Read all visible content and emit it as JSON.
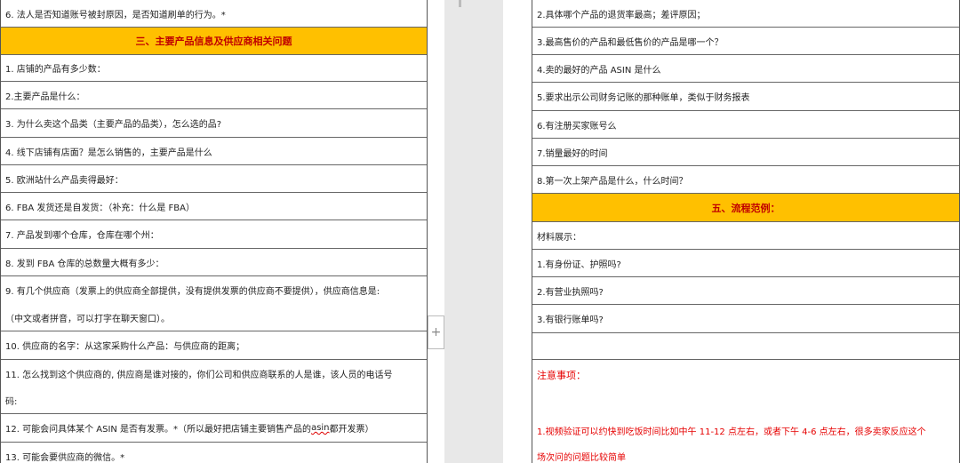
{
  "left": {
    "rows": [
      {
        "text": "6. 法人是否知道账号被封原因，是否知道刷单的行为。*"
      },
      {
        "text": "三、主要产品信息及供应商相关问题"
      },
      {
        "text": "1. 店铺的产品有多少数："
      },
      {
        "text": "2.主要产品是什么："
      },
      {
        "text": "3. 为什么卖这个品类（主要产品的品类），怎么选的品?"
      },
      {
        "text": "4. 线下店铺有店面？是怎么销售的，主要产品是什么"
      },
      {
        "text": "5. 欧洲站什么产品卖得最好："
      },
      {
        "text": "6. FBA 发货还是自发货：（补充：什么是 FBA）"
      },
      {
        "text": "7. 产品发到哪个仓库，仓库在哪个州："
      },
      {
        "text": "8. 发到 FBA 仓库的总数量大概有多少："
      },
      {
        "text": "9. 有几个供应商（发票上的供应商全部提供，没有提供发票的供应商不要提供），供应商信息是:"
      },
      {
        "text": "（中文或者拼音，可以打字在聊天窗口）。"
      },
      {
        "text": "10. 供应商的名字：从这家采购什么产品：与供应商的距离；"
      },
      {
        "text": "11. 怎么找到这个供应商的, 供应商是谁对接的，你们公司和供应商联系的人是谁，该人员的电话号"
      },
      {
        "text": "码:"
      },
      {
        "text_a": "12. 可能会问具体某个 ASIN 是否有发票。*（所以最好把店铺主要销售产品的 ",
        "text_b": "asin",
        "text_c": " 都开发票）"
      },
      {
        "text": "13. 可能会要供应商的微信。*"
      }
    ]
  },
  "right": {
    "rows": [
      {
        "text": "2.具体哪个产品的退货率最高；差评原因；"
      },
      {
        "text": "3.最高售价的产品和最低售价的产品是哪一个？"
      },
      {
        "text": "4.卖的最好的产品 ASIN 是什么"
      },
      {
        "text": "5.要求出示公司财务记账的那种账单，类似于财务报表"
      },
      {
        "text": "6.有注册买家账号么"
      },
      {
        "text": "7.销量最好的时间"
      },
      {
        "text": "8.第一次上架产品是什么，什么时间？"
      },
      {
        "text": "五、流程范例："
      },
      {
        "text": "材料展示："
      },
      {
        "text": "1.有身份证、护照吗?"
      },
      {
        "text": "2.有营业执照吗?"
      },
      {
        "text": "3.有银行账单吗?"
      },
      {
        "text": ""
      },
      {
        "text": "注意事项："
      },
      {
        "text": "1.视频验证可以约快到吃饭时间比如中午 11-12 点左右，或者下午 4-6 点左右，很多卖家反应这个"
      },
      {
        "text": "场次问的问题比较简单"
      }
    ]
  },
  "add_button_label": "+",
  "colors": {
    "header_bg": "#ffc000",
    "header_text": "#c00000",
    "notice_text": "#e60000"
  }
}
